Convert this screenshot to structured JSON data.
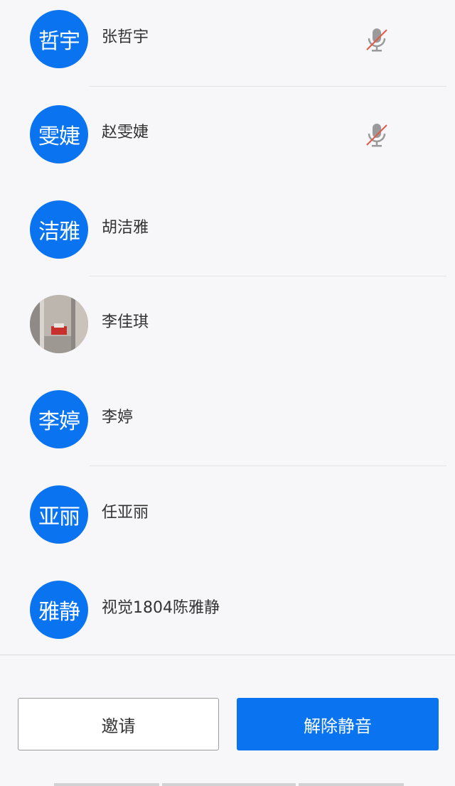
{
  "members": [
    {
      "avatar_text": "哲宇",
      "name": "张哲宇",
      "muted": true
    },
    {
      "avatar_text": "雯婕",
      "name": "赵雯婕",
      "muted": true
    },
    {
      "avatar_text": "洁雅",
      "name": "胡洁雅",
      "muted": false
    },
    {
      "avatar_text": "",
      "name": "李佳琪",
      "muted": false,
      "photo": true
    },
    {
      "avatar_text": "李婷",
      "name": "李婷",
      "muted": false
    },
    {
      "avatar_text": "亚丽",
      "name": "任亚丽",
      "muted": false
    },
    {
      "avatar_text": "雅静",
      "name": "视觉1804陈雅静",
      "muted": false
    }
  ],
  "actions": {
    "invite_label": "邀请",
    "unmute_label": "解除静音"
  },
  "colors": {
    "accent": "#0a74f0",
    "muted_slash": "#e05a4a",
    "mic_gray": "#9a9a9a"
  }
}
